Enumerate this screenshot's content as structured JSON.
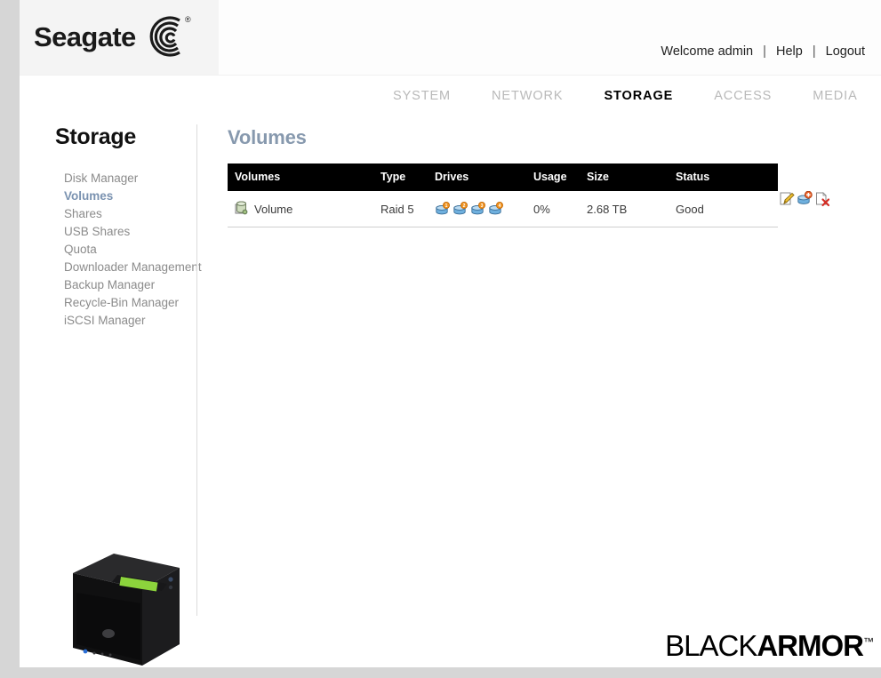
{
  "brand": {
    "name": "Seagate",
    "registered_mark": "®",
    "logo_icon": "seagate-swirl-logo"
  },
  "header": {
    "welcome": "Welcome admin",
    "separator": "|",
    "help": "Help",
    "logout": "Logout"
  },
  "nav": {
    "items": [
      {
        "label": "SYSTEM",
        "active": false
      },
      {
        "label": "NETWORK",
        "active": false
      },
      {
        "label": "STORAGE",
        "active": true
      },
      {
        "label": "ACCESS",
        "active": false
      },
      {
        "label": "MEDIA",
        "active": false
      }
    ]
  },
  "sidebar": {
    "title": "Storage",
    "items": [
      {
        "label": "Disk Manager",
        "active": false
      },
      {
        "label": "Volumes",
        "active": true
      },
      {
        "label": "Shares",
        "active": false
      },
      {
        "label": "USB Shares",
        "active": false
      },
      {
        "label": "Quota",
        "active": false
      },
      {
        "label": "Downloader Management",
        "active": false
      },
      {
        "label": "Backup Manager",
        "active": false
      },
      {
        "label": "Recycle-Bin Manager",
        "active": false
      },
      {
        "label": "iSCSI Manager",
        "active": false
      }
    ],
    "device_image_name": "blackarmor-nas-device"
  },
  "main": {
    "page_title": "Volumes",
    "table": {
      "columns": [
        "Volumes",
        "Type",
        "Drives",
        "Usage",
        "Size",
        "Status"
      ],
      "rows": [
        {
          "volume_icon": "volume-disk-icon",
          "volume": "Volume",
          "type": "Raid 5",
          "drives": [
            "1",
            "2",
            "3",
            "4"
          ],
          "usage": "0%",
          "size": "2.68 TB",
          "status": "Good"
        }
      ]
    },
    "row_actions": [
      {
        "name": "edit-volume-icon",
        "title": "Edit"
      },
      {
        "name": "add-disk-icon",
        "title": "Add disk"
      },
      {
        "name": "delete-volume-icon",
        "title": "Delete"
      }
    ]
  },
  "footer": {
    "logo_light": "BLACK",
    "logo_bold": "ARMOR",
    "trademark": "™"
  },
  "colors": {
    "nav_active": "#000000",
    "nav_inactive": "#b9b9b9",
    "sidebar_active": "#7a92b0",
    "page_title": "#8799ae",
    "table_header_bg": "#000000",
    "drive_badge": "#f0921e",
    "drive_body": "#5c9fd8"
  }
}
